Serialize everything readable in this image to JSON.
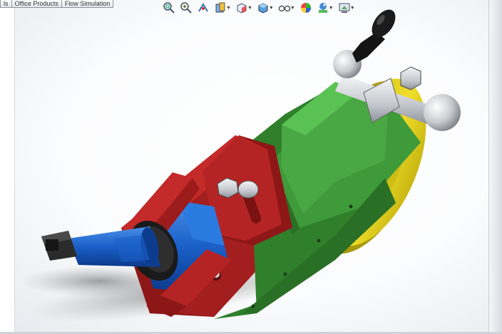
{
  "tabs": [
    {
      "label": "ls"
    },
    {
      "label": "Office Products"
    },
    {
      "label": "Flow Simulation"
    }
  ],
  "toolbar": {
    "buttons": [
      {
        "icon": "zoom-to-fit-icon"
      },
      {
        "icon": "zoom-to-area-icon"
      },
      {
        "icon": "previous-view-icon"
      },
      {
        "icon": "section-view-icon"
      },
      {
        "icon": "view-orientation-icon"
      },
      {
        "icon": "display-style-icon"
      },
      {
        "icon": "hide-show-items-icon"
      },
      {
        "icon": "edit-appearance-icon"
      },
      {
        "icon": "apply-scene-icon"
      },
      {
        "icon": "view-settings-icon"
      }
    ]
  },
  "colors": {
    "red": "#b02020",
    "green": "#3f9a3a",
    "yellow": "#e3d21c",
    "blue": "#1f6fd6",
    "steel": "#c9ccd1",
    "black": "#141414"
  }
}
